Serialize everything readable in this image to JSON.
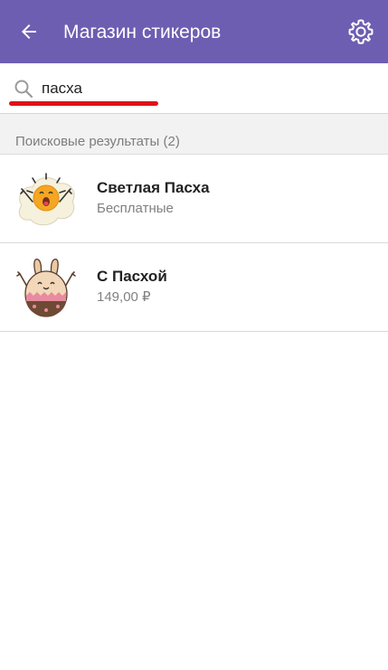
{
  "appbar": {
    "title": "Магазин стикеров",
    "back_icon": "arrow-left-icon",
    "settings_icon": "gear-icon",
    "color": "#6d5eb2"
  },
  "search": {
    "value": "пасха",
    "icon": "search-icon",
    "highlight_color": "#e0111a"
  },
  "results": {
    "header": "Поисковые результаты (2)",
    "items": [
      {
        "title": "Светлая Пасха",
        "price": "Бесплатные",
        "icon": "sun-egg-sticker"
      },
      {
        "title": "С Пасхой",
        "price": "149,00 ₽",
        "icon": "bunny-egg-sticker"
      }
    ]
  }
}
